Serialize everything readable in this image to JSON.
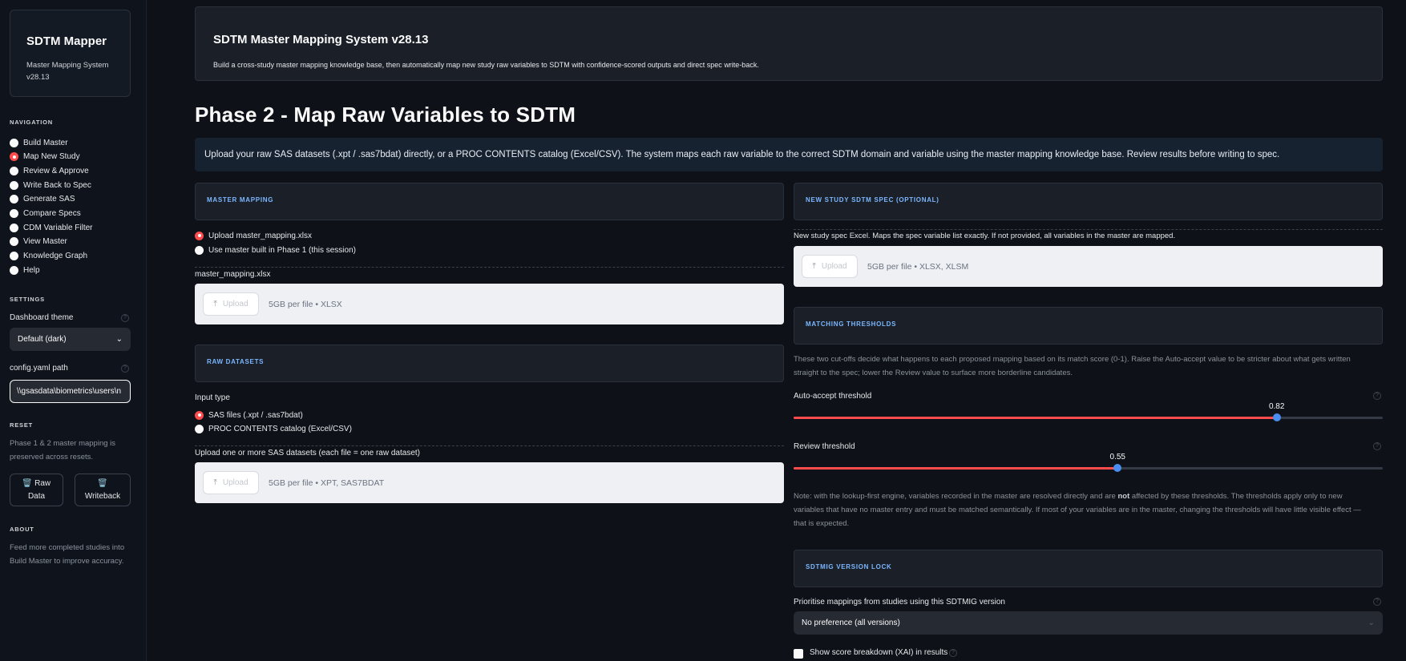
{
  "sidebar": {
    "brand_title": "SDTM Mapper",
    "brand_sub_1": "Master Mapping System",
    "brand_sub_2": "v28.13",
    "nav_heading": "NAVIGATION",
    "nav": [
      {
        "label": "Build Master",
        "selected": false
      },
      {
        "label": "Map New Study",
        "selected": true
      },
      {
        "label": "Review & Approve",
        "selected": false
      },
      {
        "label": "Write Back to Spec",
        "selected": false
      },
      {
        "label": "Generate SAS",
        "selected": false
      },
      {
        "label": "Compare Specs",
        "selected": false
      },
      {
        "label": "CDM Variable Filter",
        "selected": false
      },
      {
        "label": "View Master",
        "selected": false
      },
      {
        "label": "Knowledge Graph",
        "selected": false
      },
      {
        "label": "Help",
        "selected": false
      }
    ],
    "settings_heading": "SETTINGS",
    "theme_label": "Dashboard theme",
    "theme_value": "Default (dark)",
    "config_label": "config.yaml path",
    "config_value": "\\\\gsasdata\\biometrics\\users\\n",
    "reset_heading": "RESET",
    "reset_note_1": "Phase 1 & 2 master mapping is",
    "reset_note_2": "preserved across resets.",
    "btn_raw_1": "🗑️ Raw",
    "btn_raw_2": "Data",
    "btn_wb_1": "🗑️",
    "btn_wb_2": "Writeback",
    "about_heading": "ABOUT",
    "about_1": "Feed more completed studies into",
    "about_2": "Build Master to improve accuracy."
  },
  "hero": {
    "title": "SDTM Master Mapping System v28.13",
    "subtitle": "Build a cross-study master mapping knowledge base, then automatically map new study raw variables to SDTM with confidence-scored outputs and direct spec write-back."
  },
  "page_title": "Phase 2 - Map Raw Variables to SDTM",
  "info_banner": "Upload your raw SAS datasets (.xpt / .sas7bdat) directly, or a PROC CONTENTS catalog (Excel/CSV). The system maps each raw variable to the correct SDTM domain and variable using the master mapping knowledge base. Review results before writing to spec.",
  "left": {
    "master_section": "MASTER MAPPING",
    "master_opt_1": "Upload master_mapping.xlsx",
    "master_opt_2": "Use master built in Phase 1 (this session)",
    "master_uploader_label": "master_mapping.xlsx",
    "upload_btn": "Upload",
    "master_limit": "5GB per file • XLSX",
    "raw_section": "RAW DATASETS",
    "input_type_label": "Input type",
    "raw_opt_1": "SAS files (.xpt / .sas7bdat)",
    "raw_opt_2": "PROC CONTENTS catalog (Excel/CSV)",
    "raw_uploader_label": "Upload one or more SAS datasets (each file = one raw dataset)",
    "raw_limit": "5GB per file • XPT, SAS7BDAT"
  },
  "right": {
    "spec_section": "NEW STUDY SDTM SPEC (OPTIONAL)",
    "spec_uploader_label": "New study spec Excel. Maps the spec variable list exactly. If not provided, all variables in the master are mapped.",
    "spec_limit": "5GB per file • XLSX, XLSM",
    "thresholds_section": "MATCHING THRESHOLDS",
    "thresholds_help_1": "These two cut-offs decide what happens to each proposed mapping based on its match score (0-1). Raise the Auto-accept value to be stricter about what gets written",
    "thresholds_help_2": "straight to the spec; lower the Review value to surface more borderline candidates.",
    "auto_label": "Auto-accept threshold",
    "auto_value": 0.82,
    "auto_value_text": "0.82",
    "review_label": "Review threshold",
    "review_value": 0.55,
    "review_value_text": "0.55",
    "note_1a": "Note: with the lookup-first engine, variables recorded in the master are resolved directly and are ",
    "note_1b": "not",
    "note_1c": " affected by these thresholds. The thresholds apply only to new",
    "note_2": "variables that have no master entry and must be matched semantically. If most of your variables are in the master, changing the thresholds will have little visible effect —",
    "note_3": "that is expected.",
    "version_section": "SDTMIG VERSION LOCK",
    "version_label": "Prioritise mappings from studies using this SDTMIG version",
    "version_value": "No preference (all versions)",
    "xai_label": "Show score breakdown (XAI) in results"
  },
  "colors": {
    "accent": "#ff4b4b",
    "thumb": "#4a8df0",
    "section_heading": "#7cb7ff"
  }
}
